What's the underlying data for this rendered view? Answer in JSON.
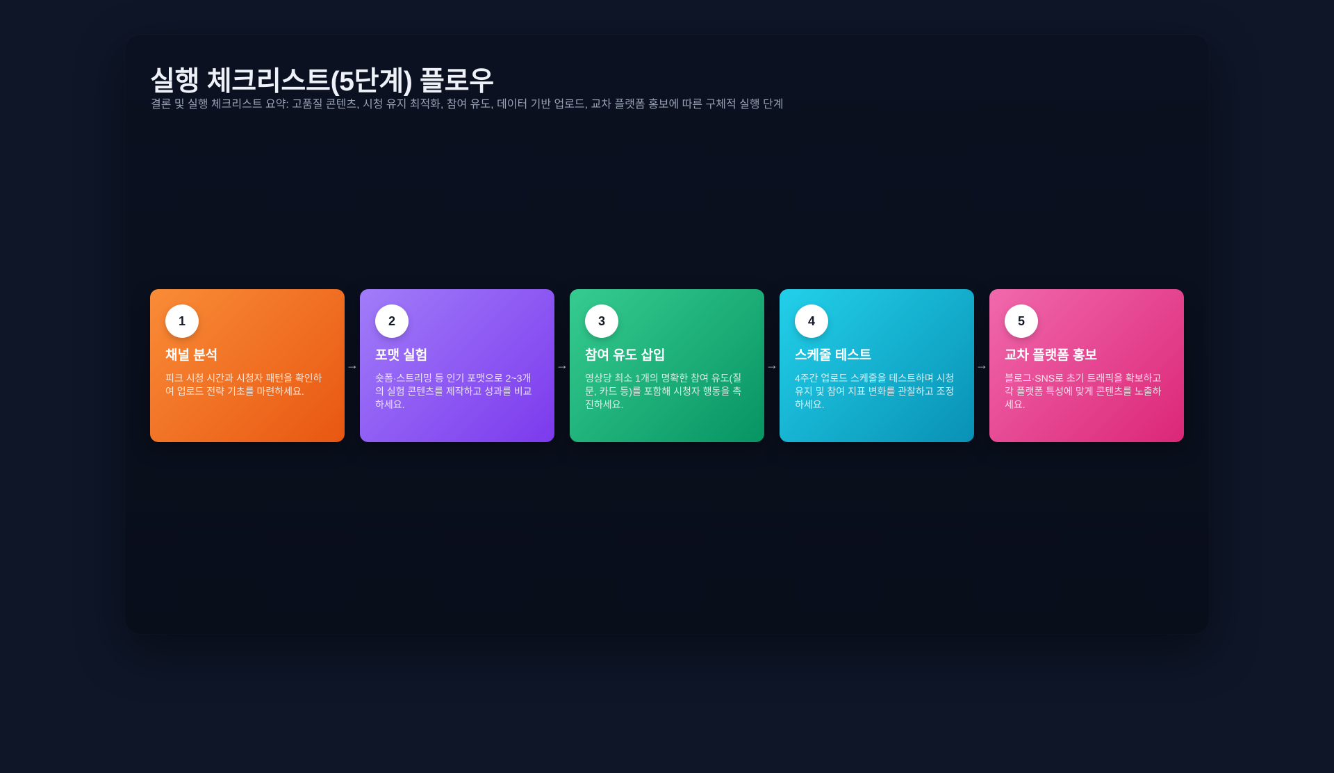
{
  "header": {
    "title": "실행 체크리스트(5단계) 플로우",
    "subtitle": "결론 및 실행 체크리스트 요약: 고품질 콘텐츠, 시청 유지 최적화, 참여 유도, 데이터 기반 업로드, 교차 플랫폼 홍보에 따른 구체적 실행 단계"
  },
  "steps": [
    {
      "number": "1",
      "title": "채널 분석",
      "description": "피크 시청 시간과 시청자 패턴을 확인하여 업로드 전략 기초를 마련하세요.",
      "color": "#f97316"
    },
    {
      "number": "2",
      "title": "포맷 실험",
      "description": "숏폼·스트리밍 등 인기 포맷으로 2~3개의 실험 콘텐츠를 제작하고 성과를 비교하세요.",
      "color": "#8b5cf6"
    },
    {
      "number": "3",
      "title": "참여 유도 삽입",
      "description": "영상당 최소 1개의 명확한 참여 유도(질문, 카드 등)를 포함해 시청자 행동을 촉진하세요.",
      "color": "#10b981"
    },
    {
      "number": "4",
      "title": "스케줄 테스트",
      "description": "4주간 업로드 스케줄을 테스트하며 시청 유지 및 참여 지표 변화를 관찰하고 조정하세요.",
      "color": "#06b6d4"
    },
    {
      "number": "5",
      "title": "교차 플랫폼 홍보",
      "description": "블로그·SNS로 초기 트래픽을 확보하고 각 플랫폼 특성에 맞게 콘텐츠를 노출하세요.",
      "color": "#ec4899"
    }
  ],
  "connector": {
    "symbol": "→",
    "icon": "arrow-right-icon"
  }
}
